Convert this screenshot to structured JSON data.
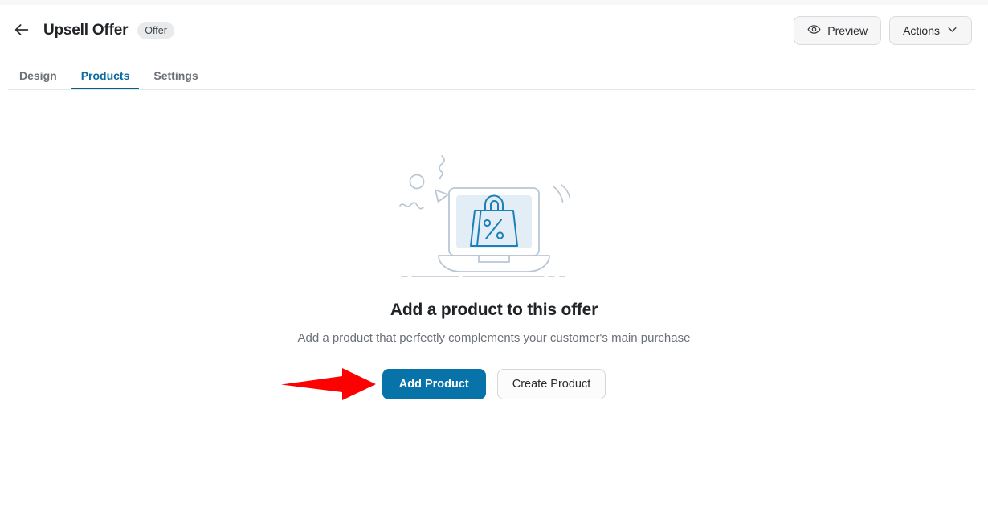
{
  "header": {
    "back_icon": "arrow-left-icon",
    "title": "Upsell Offer",
    "badge": "Offer",
    "preview_label": "Preview",
    "preview_icon": "eye-icon",
    "actions_label": "Actions",
    "actions_icon": "chevron-down-icon"
  },
  "tabs": [
    {
      "label": "Design",
      "active": false
    },
    {
      "label": "Products",
      "active": true
    },
    {
      "label": "Settings",
      "active": false
    }
  ],
  "empty_state": {
    "illustration_name": "laptop-shopping-bag-discount-illustration",
    "title": "Add a product to this offer",
    "subtitle": "Add a product that perfectly complements your customer's main purchase",
    "primary_button": "Add Product",
    "secondary_button": "Create Product"
  },
  "annotation": {
    "arrow_name": "red-pointer-arrow",
    "color": "#FF0000",
    "points_to": "Add Product"
  },
  "colors": {
    "accent_blue": "#0773A8",
    "tab_active": "#00618F",
    "text_primary": "#1F2326",
    "text_muted": "#6B7177",
    "border": "#D9DBDE",
    "badge_bg": "#E9EAEB",
    "illustration_line": "#B9C6D4",
    "illustration_screen": "#E3EDF5",
    "illustration_bag": "#1B7FB8"
  }
}
